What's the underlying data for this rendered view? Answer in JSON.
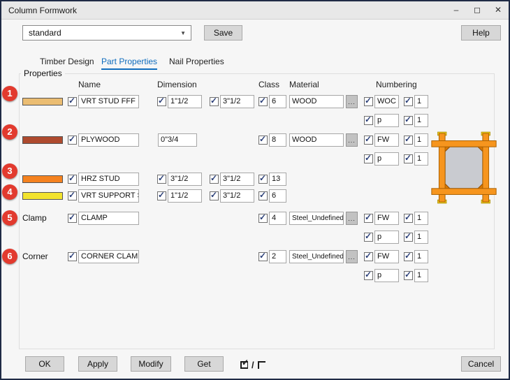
{
  "window": {
    "title": "Column Formwork"
  },
  "icons": {
    "minimize": "–",
    "maximize": "◻",
    "close": "✕",
    "dropdown_arrow": "▼"
  },
  "labels": {
    "browse": "..."
  },
  "toolbar": {
    "preset_value": "standard",
    "save_label": "Save",
    "help_label": "Help"
  },
  "tabs": [
    {
      "label": "Timber Design"
    },
    {
      "label": "Part Properties"
    },
    {
      "label": "Nail Properties"
    }
  ],
  "properties": {
    "group_label": "Properties",
    "headers": {
      "name": "Name",
      "dimension": "Dimension",
      "class": "Class",
      "material": "Material",
      "numbering": "Numbering"
    },
    "rows": [
      {
        "marker": "1",
        "swatch_color": "#EBBD72",
        "name": "VRT STUD FFF",
        "dim1": "1\"1/2",
        "dim2": "3\"1/2",
        "class": "6",
        "material": "WOOD",
        "num1a": "WOC",
        "num1b": "1",
        "num2a": "p",
        "num2b": "1"
      },
      {
        "marker": "2",
        "swatch_color": "#AE4A2E",
        "name": "PLYWOOD",
        "dim1": "0\"3/4",
        "class": "8",
        "material": "WOOD",
        "num1a": "FW",
        "num1b": "1",
        "num2a": "p",
        "num2b": "1"
      },
      {
        "marker": "3",
        "swatch_color": "#F5821F",
        "name": "HRZ STUD",
        "dim1": "3\"1/2",
        "dim2": "3\"1/2",
        "class": "13"
      },
      {
        "marker": "4",
        "swatch_color": "#F2E32E",
        "name": "VRT SUPPORT STUD",
        "dim1": "1\"1/2",
        "dim2": "3\"1/2",
        "class": "6"
      },
      {
        "marker": "5",
        "side_label": "Clamp",
        "name": "CLAMP",
        "class": "4",
        "material": "Steel_Undefined",
        "num1a": "FW",
        "num1b": "1",
        "num2a": "p",
        "num2b": "1"
      },
      {
        "marker": "6",
        "side_label": "Corner",
        "name": "CORNER CLAMP",
        "class": "2",
        "material": "Steel_Undefined",
        "num1a": "FW",
        "num1b": "1",
        "num2a": "p",
        "num2b": "1"
      }
    ]
  },
  "markers": [
    "1",
    "2",
    "3",
    "4",
    "5",
    "6"
  ],
  "footer": {
    "ok": "OK",
    "apply": "Apply",
    "modify": "Modify",
    "get": "Get",
    "cancel": "Cancel",
    "toggle_separator": "/"
  },
  "colors": {
    "accent_tab": "#0F6CBD",
    "marker_red": "#E23A2E",
    "formwork_orange": "#F6951E"
  }
}
